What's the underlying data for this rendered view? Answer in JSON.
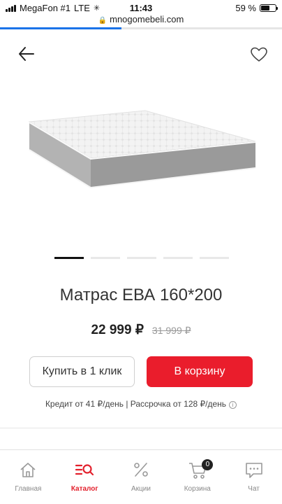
{
  "status_bar": {
    "carrier": "MegaFon #1",
    "network": "LTE",
    "time": "11:43",
    "battery_percent": "59 %",
    "battery_level": 0.59
  },
  "browser": {
    "url": "mnogomebeli.com",
    "load_progress": 0.43
  },
  "product": {
    "title": "Матрас ЕВА 160*200",
    "price": "22 999 ₽",
    "old_price": "31 999 ₽",
    "gallery": {
      "count": 5,
      "active_index": 0
    },
    "buy_one_click_label": "Купить в 1 клик",
    "add_to_cart_label": "В корзину",
    "credit_text": "Кредит от 41 ₽/день | Рассрочка от 128 ₽/день",
    "info_icon": "i"
  },
  "colors": {
    "accent": "#ea1d2c",
    "link": "#1a73e8"
  },
  "bottom_nav": {
    "items": [
      {
        "label": "Главная",
        "icon": "home-icon",
        "active": false
      },
      {
        "label": "Каталог",
        "icon": "catalog-icon",
        "active": true
      },
      {
        "label": "Акции",
        "icon": "percent-icon",
        "active": false
      },
      {
        "label": "Корзина",
        "icon": "cart-icon",
        "active": false,
        "badge": "0"
      },
      {
        "label": "Чат",
        "icon": "chat-icon",
        "active": false
      }
    ]
  }
}
